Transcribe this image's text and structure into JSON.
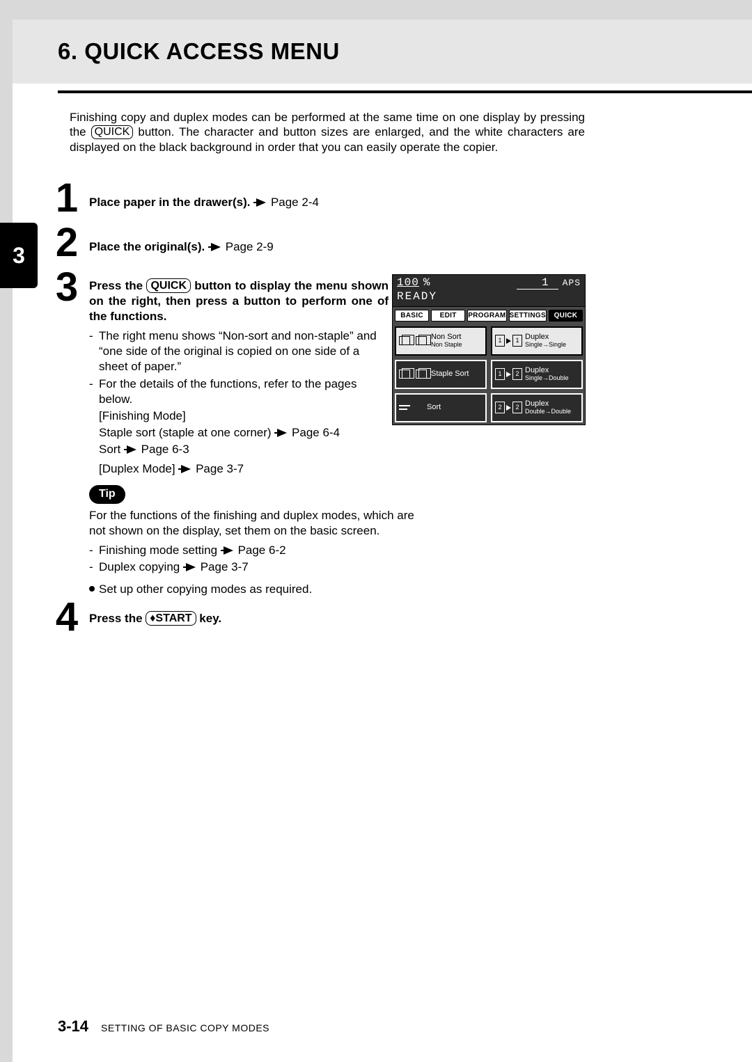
{
  "header": {
    "title": "6. QUICK ACCESS MENU"
  },
  "intro": {
    "before_quick": "Finishing copy and duplex modes can be performed at the same time on one display by pressing the ",
    "quick_label": "QUICK",
    "after_quick": " button. The character and button sizes are enlarged, and the white characters are displayed on the black background in order that you can easily operate the copier."
  },
  "chapter_tab": "3",
  "steps": {
    "s1": {
      "num": "1",
      "text": "Place paper in the drawer(s).",
      "ref": "Page 2-4"
    },
    "s2": {
      "num": "2",
      "text": "Place the original(s).",
      "ref": "Page 2-9"
    },
    "s3": {
      "num": "3",
      "line_a": "Press the ",
      "quick": "QUICK",
      "line_b": " button to display the menu shown on the right, then press a button to perform one of the functions.",
      "dash1": "The right menu shows “Non-sort and non-staple” and “one side of the original is copied on one side of a sheet of paper.”",
      "dash2": "For the details of the functions, refer to the pages below.",
      "finishing_mode": "[Finishing Mode]",
      "staple_sort": "Staple sort (staple at one corner)",
      "staple_ref": "Page 6-4",
      "sort": "Sort",
      "sort_ref": "Page 6-3",
      "duplex_mode": "[Duplex Mode]",
      "duplex_ref": "Page 3-7"
    },
    "tip": {
      "label": "Tip",
      "text": "For the functions of the finishing and duplex modes, which are not shown on the display, set them on the basic screen.",
      "dash1": "Finishing mode setting",
      "dash1_ref": "Page 6-2",
      "dash2": "Duplex copying",
      "dash2_ref": "Page 3-7",
      "bullet": "Set up other copying modes as required."
    },
    "s4": {
      "num": "4",
      "line_a": "Press the ",
      "start": "♦START",
      "line_b": " key."
    }
  },
  "lcd": {
    "pct_value": "100",
    "pct_sign": "%",
    "copies": "1",
    "aps": "APS",
    "ready": "READY",
    "tabs": [
      "BASIC",
      "EDIT",
      "PROGRAM",
      "SETTINGS",
      "QUICK"
    ],
    "cells": {
      "c00a": "Non Sort",
      "c00b": "Non Staple",
      "c01a": "Duplex",
      "c01b": "Single→Single",
      "c10": "Staple Sort",
      "c11a": "Duplex",
      "c11b": "Single→Double",
      "c20": "Sort",
      "c21a": "Duplex",
      "c21b": "Double→Double"
    }
  },
  "footer": {
    "page": "3-14",
    "section": "SETTING OF BASIC COPY MODES"
  }
}
